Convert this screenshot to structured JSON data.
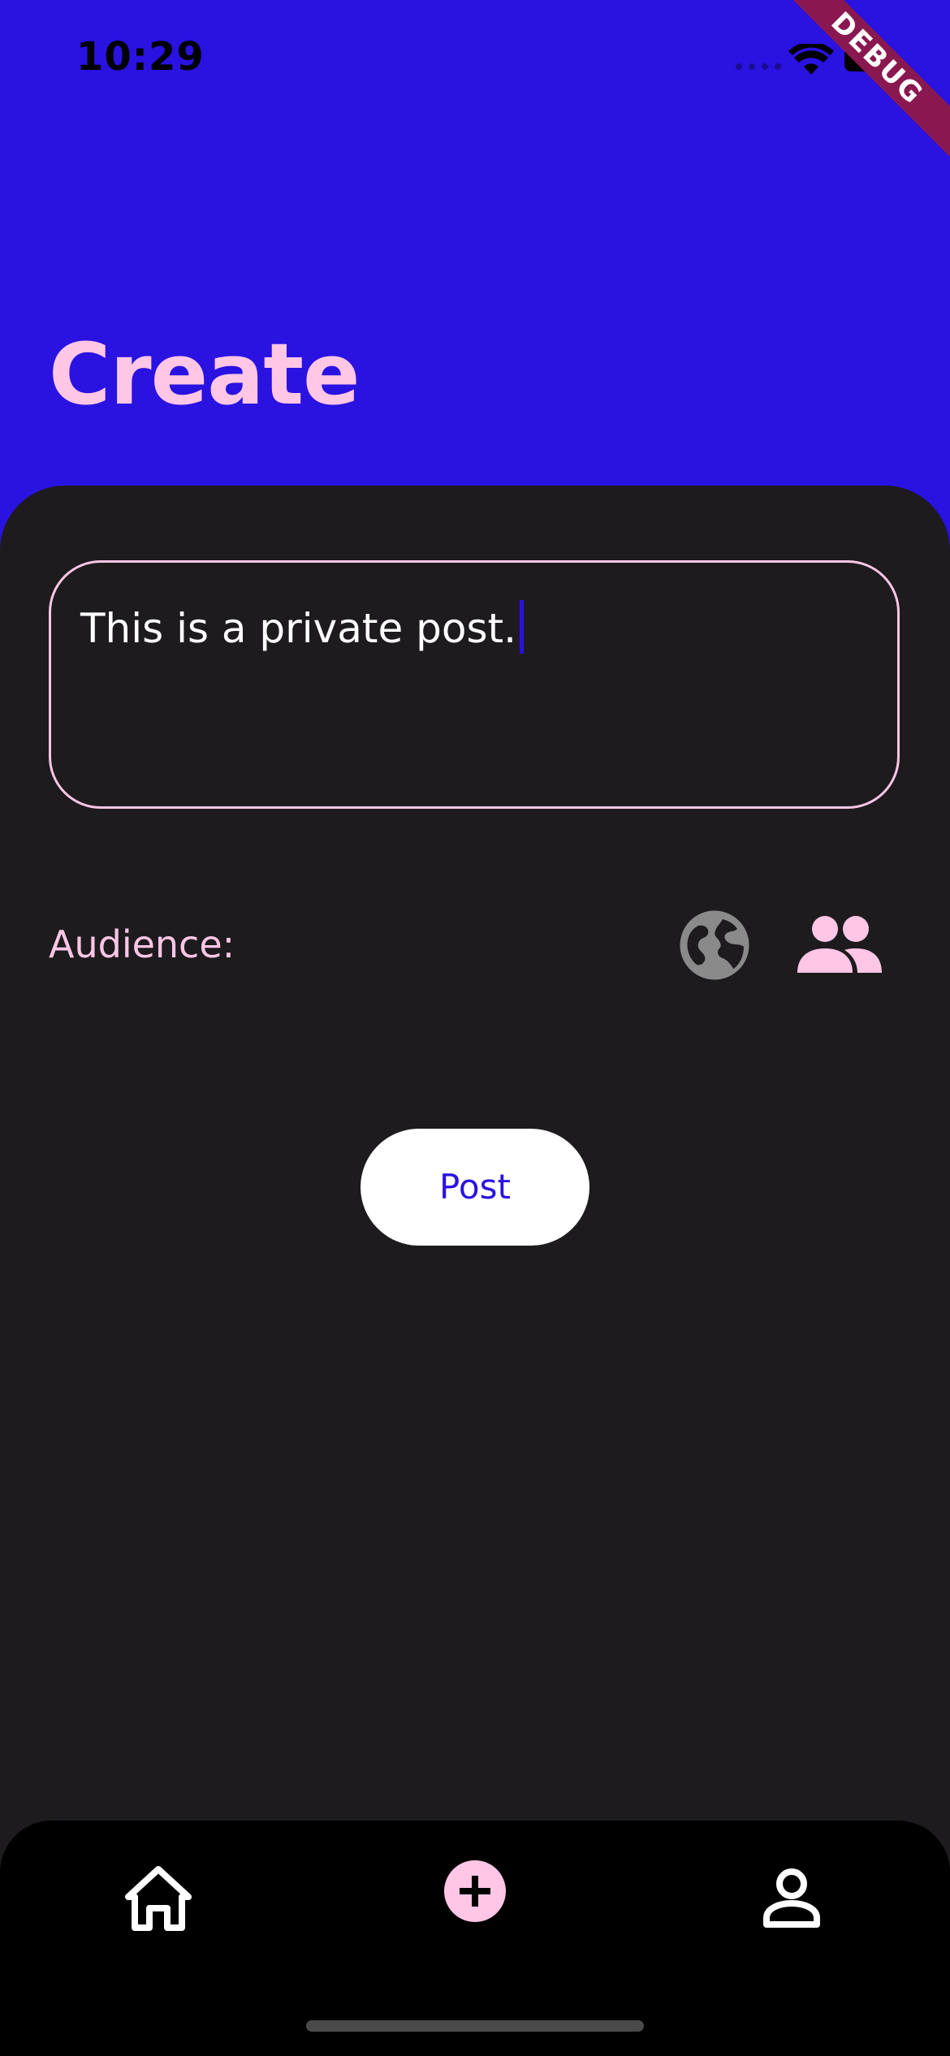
{
  "status_bar": {
    "time": "10:29",
    "debug_label": "DEBUG"
  },
  "header": {
    "title": "Create"
  },
  "post_field": {
    "value": "This is a private post."
  },
  "audience": {
    "label": "Audience:",
    "options": [
      {
        "icon": "globe-icon",
        "selected": false
      },
      {
        "icon": "group-icon",
        "selected": true
      }
    ]
  },
  "actions": {
    "post_label": "Post"
  },
  "bottom_nav": {
    "items": [
      {
        "icon": "home-icon"
      },
      {
        "icon": "add-icon",
        "active": true
      },
      {
        "icon": "profile-icon"
      }
    ]
  },
  "colors": {
    "brand": "#2a12e0",
    "accent": "#ffc6e6",
    "background": "#1d1b1e",
    "inactive_icon": "#8a8a8a"
  }
}
